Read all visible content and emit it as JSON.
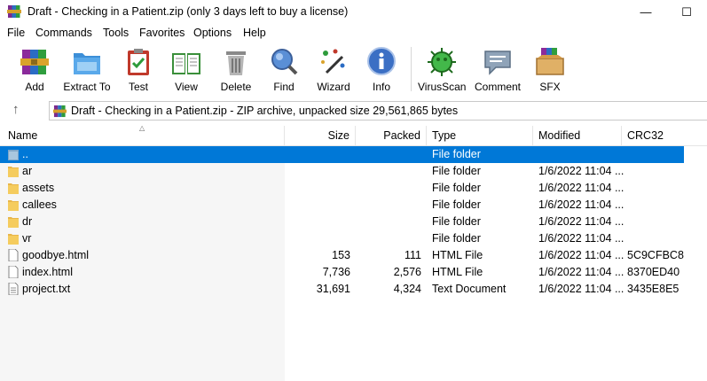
{
  "window": {
    "title": "Draft - Checking in a Patient.zip (only 3 days left to buy a license)"
  },
  "menu": [
    "File",
    "Commands",
    "Tools",
    "Favorites",
    "Options",
    "Help"
  ],
  "toolbar": [
    {
      "label": "Add",
      "icon": "rar-books-icon"
    },
    {
      "label": "Extract To",
      "icon": "folder-icon"
    },
    {
      "label": "Test",
      "icon": "clipboard-check-icon"
    },
    {
      "label": "View",
      "icon": "book-icon"
    },
    {
      "label": "Delete",
      "icon": "trash-icon"
    },
    {
      "label": "Find",
      "icon": "magnifier-icon"
    },
    {
      "label": "Wizard",
      "icon": "wand-icon"
    },
    {
      "label": "Info",
      "icon": "info-icon"
    },
    {
      "label": "VirusScan",
      "icon": "virus-icon"
    },
    {
      "label": "Comment",
      "icon": "comment-icon"
    },
    {
      "label": "SFX",
      "icon": "box-icon"
    }
  ],
  "address": {
    "path": "Draft - Checking in a Patient.zip - ZIP archive, unpacked size 29,561,865 bytes"
  },
  "columns": [
    "Name",
    "Size",
    "Packed",
    "Type",
    "Modified",
    "CRC32"
  ],
  "rows": [
    {
      "name": "..",
      "size": "",
      "packed": "",
      "type": "File folder",
      "modified": "",
      "crc": "",
      "icon": "folder-up-icon"
    },
    {
      "name": "ar",
      "size": "",
      "packed": "",
      "type": "File folder",
      "modified": "1/6/2022 11:04 ...",
      "crc": "",
      "icon": "folder-icon"
    },
    {
      "name": "assets",
      "size": "",
      "packed": "",
      "type": "File folder",
      "modified": "1/6/2022 11:04 ...",
      "crc": "",
      "icon": "folder-icon"
    },
    {
      "name": "callees",
      "size": "",
      "packed": "",
      "type": "File folder",
      "modified": "1/6/2022 11:04 ...",
      "crc": "",
      "icon": "folder-icon"
    },
    {
      "name": "dr",
      "size": "",
      "packed": "",
      "type": "File folder",
      "modified": "1/6/2022 11:04 ...",
      "crc": "",
      "icon": "folder-icon"
    },
    {
      "name": "vr",
      "size": "",
      "packed": "",
      "type": "File folder",
      "modified": "1/6/2022 11:04 ...",
      "crc": "",
      "icon": "folder-icon"
    },
    {
      "name": "goodbye.html",
      "size": "153",
      "packed": "111",
      "type": "HTML File",
      "modified": "1/6/2022 11:04 ...",
      "crc": "5C9CFBC8",
      "icon": "file-icon"
    },
    {
      "name": "index.html",
      "size": "7,736",
      "packed": "2,576",
      "type": "HTML File",
      "modified": "1/6/2022 11:04 ...",
      "crc": "8370ED40",
      "icon": "file-icon"
    },
    {
      "name": "project.txt",
      "size": "31,691",
      "packed": "4,324",
      "type": "Text Document",
      "modified": "1/6/2022 11:04 ...",
      "crc": "3435E8E5",
      "icon": "text-file-icon"
    }
  ]
}
